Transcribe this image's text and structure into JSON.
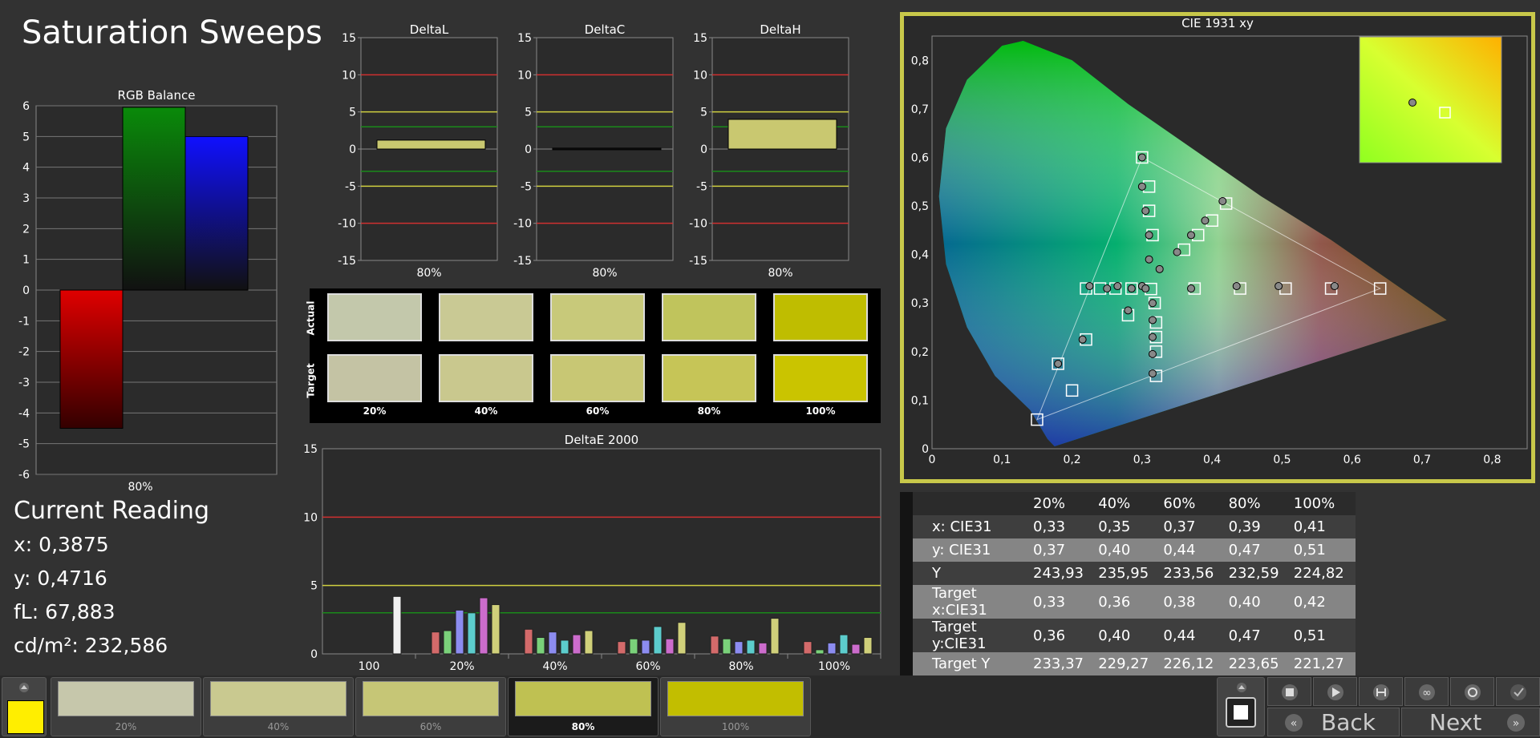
{
  "page": {
    "title": "Saturation Sweeps"
  },
  "rgb_balance": {
    "title": "RGB Balance",
    "category": "80%",
    "ylim": [
      -6,
      6
    ],
    "ticks": [
      "6",
      "5",
      "4",
      "3",
      "2",
      "1",
      "0",
      "-1",
      "-2",
      "-3",
      "-4",
      "-5",
      "-6"
    ],
    "series": [
      {
        "name": "R",
        "value": -4.5,
        "color": "#e00000"
      },
      {
        "name": "G",
        "value": 5.95,
        "color": "#0a8a0a"
      },
      {
        "name": "B",
        "value": 5.0,
        "color": "#1010ff"
      }
    ]
  },
  "delta_charts": [
    {
      "title": "DeltaL",
      "category": "80%",
      "value": 1.2,
      "ticks": [
        "15",
        "10",
        "5",
        "0",
        "-5",
        "-10",
        "-15"
      ]
    },
    {
      "title": "DeltaC",
      "category": "80%",
      "value": 0.0,
      "ticks": [
        "15",
        "10",
        "5",
        "0",
        "-5",
        "-10",
        "-15"
      ]
    },
    {
      "title": "DeltaH",
      "category": "80%",
      "value": 4.0,
      "ticks": [
        "15",
        "10",
        "5",
        "0",
        "-5",
        "-10",
        "-15"
      ]
    }
  ],
  "swatches": {
    "actual_label": "Actual",
    "target_label": "Target",
    "labels": [
      "20%",
      "40%",
      "60%",
      "80%",
      "100%"
    ],
    "actual_colors": [
      "#c3c8ab",
      "#c9c994",
      "#c8c97a",
      "#c0c45c",
      "#bfbd00"
    ],
    "target_colors": [
      "#c4c3a4",
      "#c9c88e",
      "#c8c774",
      "#c6c557",
      "#cac400"
    ]
  },
  "deltae": {
    "title": "DeltaE 2000",
    "ticks": [
      "15",
      "10",
      "5",
      "0"
    ],
    "categories": [
      "100",
      "20%",
      "40%",
      "60%",
      "80%",
      "100%"
    ],
    "groups": [
      [
        4.2
      ],
      [
        1.6,
        1.7,
        3.2,
        3.0,
        4.1,
        3.6
      ],
      [
        1.8,
        1.2,
        1.6,
        1.0,
        1.4,
        1.7
      ],
      [
        0.9,
        1.1,
        1.0,
        2.0,
        1.1,
        2.3
      ],
      [
        1.3,
        1.1,
        0.9,
        1.0,
        0.8,
        2.6
      ],
      [
        0.9,
        0.3,
        0.8,
        1.4,
        0.7,
        1.2
      ]
    ],
    "bar_colors": [
      "#d36a6a",
      "#7ad17a",
      "#8c8cf0",
      "#5ccccc",
      "#cc6ccc",
      "#d0d07a"
    ]
  },
  "cie": {
    "title": "CIE 1931 xy",
    "x_ticks": [
      "0",
      "0,1",
      "0,2",
      "0,3",
      "0,4",
      "0,5",
      "0,6",
      "0,7",
      "0,8"
    ],
    "y_ticks": [
      "0",
      "0,1",
      "0,2",
      "0,3",
      "0,4",
      "0,5",
      "0,6",
      "0,7",
      "0,8"
    ],
    "targets": [
      [
        0.64,
        0.33
      ],
      [
        0.3,
        0.6
      ],
      [
        0.15,
        0.06
      ],
      [
        0.3127,
        0.329
      ],
      [
        0.57,
        0.33
      ],
      [
        0.505,
        0.33
      ],
      [
        0.44,
        0.33
      ],
      [
        0.375,
        0.33
      ],
      [
        0.22,
        0.33
      ],
      [
        0.24,
        0.33
      ],
      [
        0.262,
        0.33
      ],
      [
        0.285,
        0.33
      ],
      [
        0.2,
        0.12
      ],
      [
        0.18,
        0.175
      ],
      [
        0.22,
        0.225
      ],
      [
        0.28,
        0.275
      ],
      [
        0.42,
        0.505
      ],
      [
        0.4,
        0.47
      ],
      [
        0.38,
        0.44
      ],
      [
        0.36,
        0.41
      ],
      [
        0.31,
        0.54
      ],
      [
        0.31,
        0.49
      ],
      [
        0.315,
        0.44
      ],
      [
        0.32,
        0.15
      ],
      [
        0.32,
        0.2
      ],
      [
        0.32,
        0.23
      ],
      [
        0.32,
        0.26
      ],
      [
        0.318,
        0.3
      ]
    ],
    "measured": [
      [
        0.3,
        0.6
      ],
      [
        0.3,
        0.54
      ],
      [
        0.305,
        0.49
      ],
      [
        0.31,
        0.44
      ],
      [
        0.31,
        0.39
      ],
      [
        0.325,
        0.37
      ],
      [
        0.35,
        0.405
      ],
      [
        0.37,
        0.44
      ],
      [
        0.39,
        0.47
      ],
      [
        0.415,
        0.51
      ],
      [
        0.575,
        0.335
      ],
      [
        0.495,
        0.335
      ],
      [
        0.435,
        0.335
      ],
      [
        0.37,
        0.33
      ],
      [
        0.3,
        0.335
      ],
      [
        0.285,
        0.33
      ],
      [
        0.265,
        0.335
      ],
      [
        0.25,
        0.33
      ],
      [
        0.225,
        0.335
      ],
      [
        0.215,
        0.225
      ],
      [
        0.18,
        0.175
      ],
      [
        0.28,
        0.285
      ],
      [
        0.315,
        0.3
      ],
      [
        0.315,
        0.265
      ],
      [
        0.315,
        0.23
      ],
      [
        0.315,
        0.195
      ],
      [
        0.315,
        0.155
      ],
      [
        0.305,
        0.33
      ]
    ]
  },
  "current_reading": {
    "title": "Current Reading",
    "lines": [
      "x: 0,3875",
      "y: 0,4716",
      "fL: 67,883",
      "cd/m²: 232,586"
    ]
  },
  "data_table": {
    "headers": [
      "20%",
      "40%",
      "60%",
      "80%",
      "100%"
    ],
    "rows": [
      {
        "label": "x: CIE31",
        "values": [
          "0,33",
          "0,35",
          "0,37",
          "0,39",
          "0,41"
        ]
      },
      {
        "label": "y: CIE31",
        "values": [
          "0,37",
          "0,40",
          "0,44",
          "0,47",
          "0,51"
        ]
      },
      {
        "label": "Y",
        "values": [
          "243,93",
          "235,95",
          "233,56",
          "232,59",
          "224,82"
        ]
      },
      {
        "label": "Target x:CIE31",
        "values": [
          "0,33",
          "0,36",
          "0,38",
          "0,40",
          "0,42"
        ]
      },
      {
        "label": "Target y:CIE31",
        "values": [
          "0,36",
          "0,40",
          "0,44",
          "0,47",
          "0,51"
        ]
      },
      {
        "label": "Target Y",
        "values": [
          "233,37",
          "229,27",
          "226,12",
          "223,65",
          "221,27"
        ]
      }
    ]
  },
  "bottom": {
    "current_color": "#ffee00",
    "tiles": [
      {
        "label": "20%",
        "color": "#c6c7ab"
      },
      {
        "label": "40%",
        "color": "#c9c990"
      },
      {
        "label": "60%",
        "color": "#c6c676"
      },
      {
        "label": "80%",
        "color": "#bfc152",
        "selected": true
      },
      {
        "label": "100%",
        "color": "#c2be00"
      }
    ],
    "back_label": "Back",
    "next_label": "Next"
  }
}
